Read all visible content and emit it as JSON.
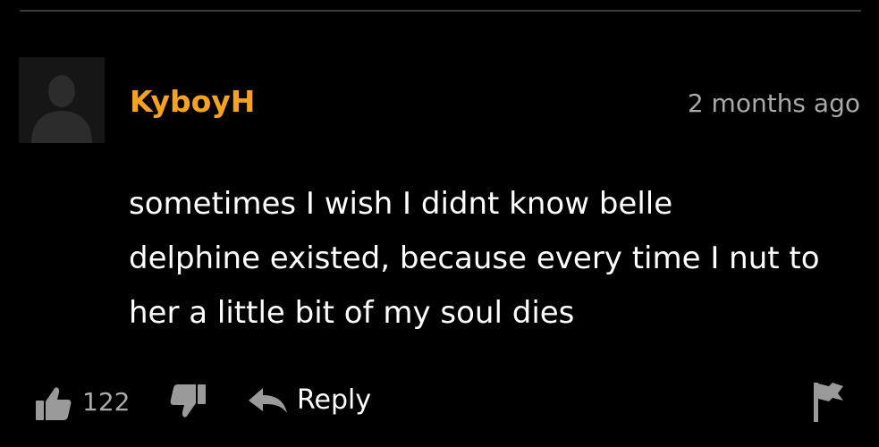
{
  "comment": {
    "username": "KyboyH",
    "timestamp": "2 months ago",
    "text_lines": [
      "sometimes I wish I didnt know belle",
      "delphine existed, because every time I nut to",
      "her a little bit of my soul dies"
    ]
  },
  "actions": {
    "like_count": "122",
    "reply_label": "Reply"
  },
  "icons": {
    "avatar": "default-user-silhouette",
    "like": "thumbs-up-icon",
    "dislike": "thumbs-down-icon",
    "reply": "reply-arrow-icon",
    "flag": "flag-icon"
  },
  "colors": {
    "background": "#000000",
    "username": "#f6a21a",
    "muted_text": "#aaaaaa",
    "body_text": "#ffffff",
    "icon": "#9a9a9a"
  }
}
